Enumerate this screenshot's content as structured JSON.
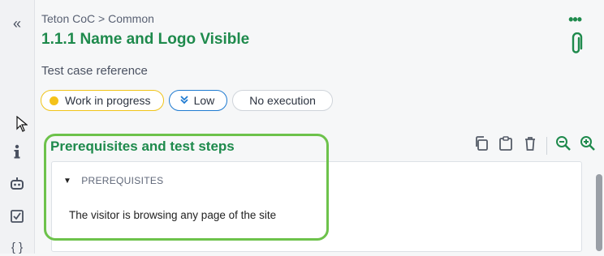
{
  "sidebar": {
    "collapse_glyph": "«",
    "icons": [
      "collapse-icon",
      "info-icon",
      "robot-icon",
      "checkbox-icon",
      "braces-icon"
    ]
  },
  "header": {
    "breadcrumb": "Teton CoC > Common",
    "title": "1.1.1 Name and Logo Visible",
    "more_glyph": "•••"
  },
  "subtitle": "Test case reference",
  "chips": {
    "status": "Work in progress",
    "priority": "Low",
    "execution": "No execution"
  },
  "section": {
    "title": "Prerequisites and test steps",
    "prerequisites_heading": "PREREQUISITES",
    "prerequisites_text": "The visitor is browsing any page of the site"
  },
  "colors": {
    "accent": "#1e8a4c",
    "highlight": "#6dc24b",
    "status_dot": "#f4c21a",
    "priority": "#1f7bd1"
  }
}
